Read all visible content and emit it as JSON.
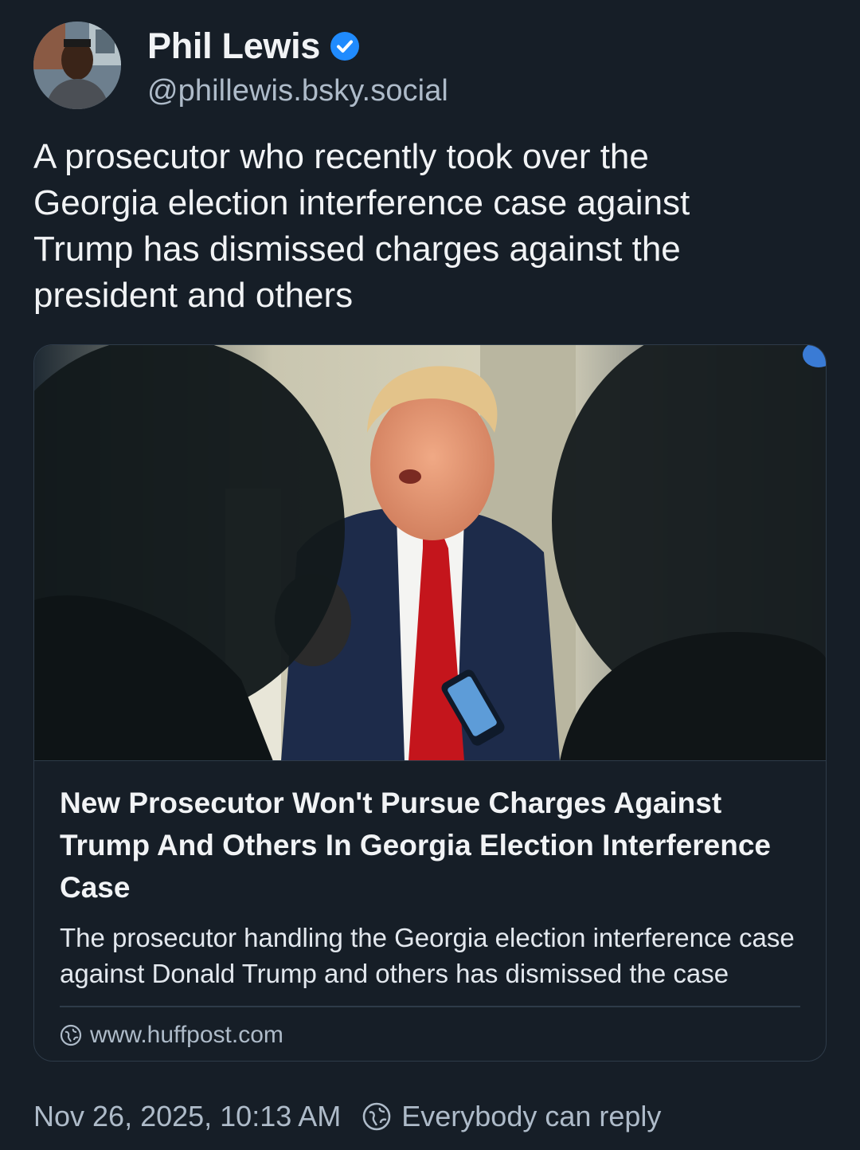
{
  "author": {
    "display_name": "Phil Lewis",
    "handle": "@phillewis.bsky.social",
    "verified_icon": "verified-check-icon",
    "avatar_icon": "avatar"
  },
  "post": {
    "text": "A prosecutor who recently took over the\nGeorgia election interference case against\nTrump has dismissed charges against the\npresident and others"
  },
  "embed": {
    "title": "New Prosecutor Won't Pursue Charges Against Trump And Others In Georgia Election Interference Case",
    "description": "The prosecutor handling the Georgia election interference case against Donald Trump and others has dismissed the case",
    "domain": "www.huffpost.com",
    "domain_icon": "globe-icon"
  },
  "footer": {
    "timestamp": "Nov 26, 2025, 10:13 AM",
    "reply_setting": "Everybody can reply",
    "reply_icon": "globe-icon"
  },
  "colors": {
    "background": "#161e27",
    "text_primary": "#f1f3f5",
    "text_secondary": "#aebbc9",
    "border": "#2e3b49",
    "verified": "#208bfe"
  }
}
